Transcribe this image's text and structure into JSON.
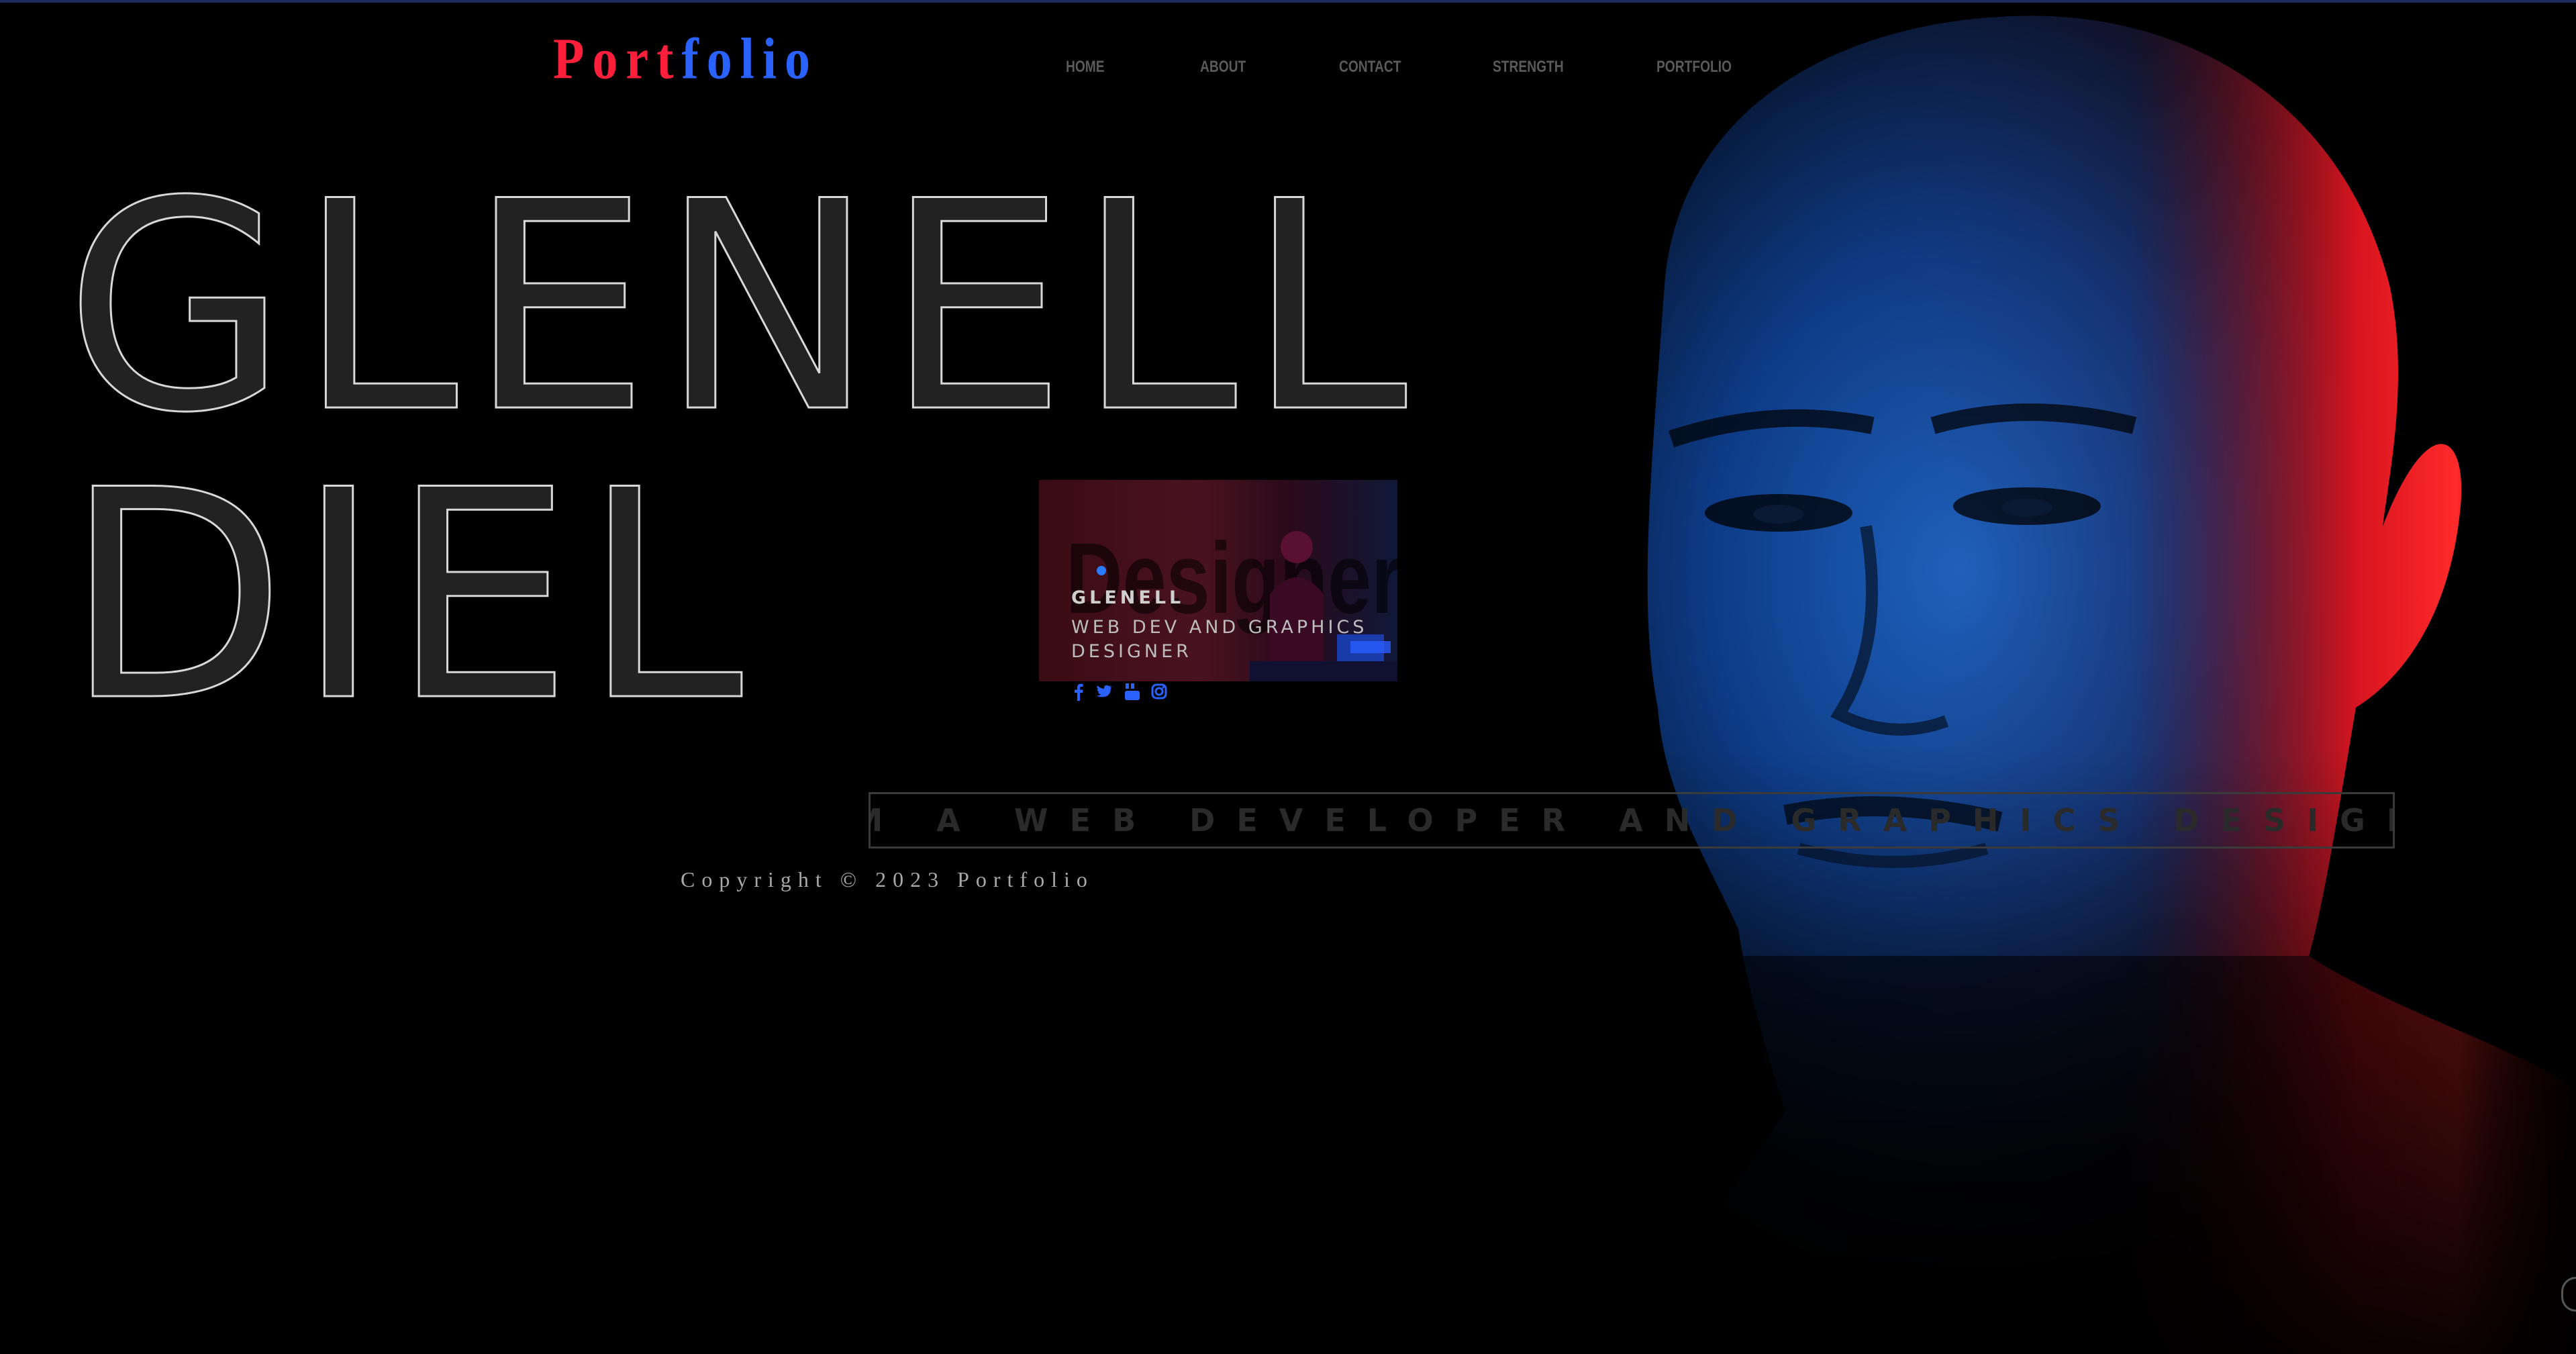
{
  "header": {
    "logo": {
      "part1": "Port",
      "part2": "folio"
    },
    "nav": [
      {
        "label": "HOME"
      },
      {
        "label": "ABOUT"
      },
      {
        "label": "CONTACT"
      },
      {
        "label": "STRENGTH"
      },
      {
        "label": "PORTFOLIO"
      }
    ]
  },
  "hero": {
    "first_name": "GLENELL",
    "last_name": "DIEL"
  },
  "card": {
    "watermark": "Designer",
    "name": "GLENELL",
    "role": "WEB DEV AND GRAPHICS DESIGNER",
    "social": [
      {
        "icon": "facebook-icon",
        "color": "#2a62ff"
      },
      {
        "icon": "twitter-icon",
        "color": "#2a62ff"
      },
      {
        "icon": "youtube-icon",
        "color": "#2a62ff"
      },
      {
        "icon": "instagram-icon",
        "color": "#2a62ff"
      }
    ]
  },
  "tagline": "I AM A WEB DEVELOPER AND GRAPHICS DESIGNER",
  "footer": {
    "copyright": "Copyright © 2023 Portfolio"
  },
  "colors": {
    "background": "#000000",
    "accent_red": "#ff1f3a",
    "accent_blue": "#2a62ff"
  }
}
